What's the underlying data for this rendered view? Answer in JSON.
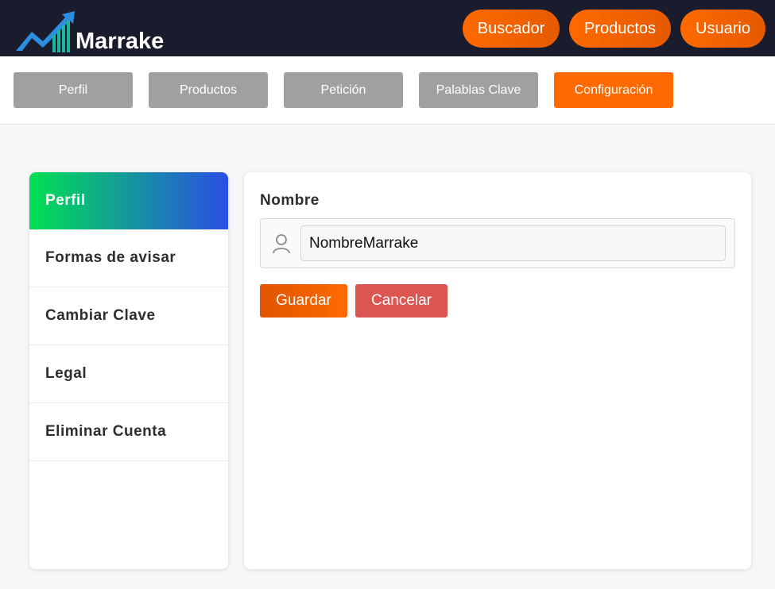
{
  "header": {
    "brand": "Marrake",
    "nav": [
      "Buscador",
      "Productos",
      "Usuario"
    ]
  },
  "tabs": [
    {
      "label": "Perfil",
      "active": false
    },
    {
      "label": "Productos",
      "active": false
    },
    {
      "label": "Petición",
      "active": false
    },
    {
      "label": "Palablas Clave",
      "active": false
    },
    {
      "label": "Configuración",
      "active": true
    }
  ],
  "sidebar": {
    "items": [
      {
        "label": "Perfil",
        "active": true
      },
      {
        "label": "Formas de avisar",
        "active": false
      },
      {
        "label": "Cambiar Clave",
        "active": false
      },
      {
        "label": "Legal",
        "active": false
      },
      {
        "label": "Eliminar Cuenta",
        "active": false
      }
    ]
  },
  "profile_form": {
    "name_label": "Nombre",
    "name_value": "NombreMarrake",
    "icon": "user-icon",
    "save_label": "Guardar",
    "cancel_label": "Cancelar"
  },
  "colors": {
    "header_bg": "#1a1c2e",
    "accent_orange": "#ff6a00",
    "tab_inactive": "#a0a0a0",
    "cancel_red": "#db5551",
    "sidebar_active_start": "#00e052",
    "sidebar_active_end": "#2a4ee6"
  }
}
